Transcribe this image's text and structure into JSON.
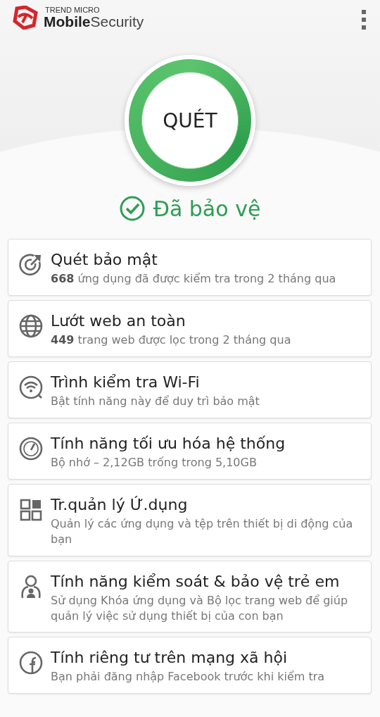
{
  "header": {
    "brand_top": "TREND MICRO",
    "brand_bold": "Mobile",
    "brand_light": "Security"
  },
  "scan_button": {
    "label": "QUÉT"
  },
  "status": {
    "text": "Đã bảo vệ",
    "protected": true
  },
  "features": [
    {
      "kind": "scan",
      "title": "Quét bảo mật",
      "subtitle": "**668** ứng dụng đã được kiểm tra trong 2 tháng qua"
    },
    {
      "kind": "web",
      "title": "Lướt web an toàn",
      "subtitle": "**449** trang web được lọc trong 2 tháng qua"
    },
    {
      "kind": "wifi",
      "title": "Trình kiểm tra Wi-Fi",
      "subtitle": "Bật tính năng này để duy trì bảo mật"
    },
    {
      "kind": "optimizer",
      "title": "Tính năng tối ưu hóa hệ thống",
      "subtitle": "Bộ nhớ – 2,12GB trống trong 5,10GB"
    },
    {
      "kind": "apps",
      "title": "Tr.quản lý Ứ.dụng",
      "subtitle": "Quản lý các ứng dụng và tệp trên thiết bị di động của bạn"
    },
    {
      "kind": "parental",
      "title": "Tính năng kiểm soát & bảo vệ trẻ em",
      "subtitle": "Sử dụng Khóa ứng dụng và Bộ lọc trang web để giúp quản lý việc sử dụng thiết bị của con bạn"
    },
    {
      "kind": "social",
      "title": "Tính riêng tư trên mạng xã hội",
      "subtitle": "Bạn phải đăng nhập Facebook trước khi kiểm tra"
    }
  ]
}
